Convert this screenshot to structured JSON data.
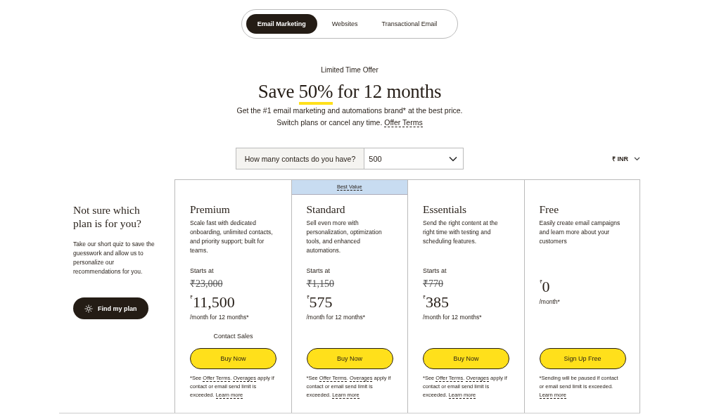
{
  "tabs": [
    {
      "label": "Email Marketing",
      "selected": true
    },
    {
      "label": "Websites",
      "selected": false
    },
    {
      "label": "Transactional Email",
      "selected": false
    }
  ],
  "offer": {
    "eyebrow": "Limited Time Offer",
    "headline_before": "Save ",
    "headline_highlight": "50%",
    "headline_after": " for 12 months",
    "subtitle": "Get the #1 email marketing and automations brand* at the best price.",
    "subtitle2": "Switch plans or cancel any time.",
    "terms_link": "Offer Terms"
  },
  "contacts": {
    "label": "How many contacts do you have?",
    "value": "500"
  },
  "currency": {
    "symbol": "₹",
    "code": "INR"
  },
  "quiz": {
    "title": "Not sure which plan is for you?",
    "text": "Take our short quiz to save the guesswork and allow us to personalize our recommendations for you.",
    "button": "Find my plan"
  },
  "plans": [
    {
      "name": "Premium",
      "description": "Scale fast with dedicated onboarding, unlimited contacts, and priority support; built for teams.",
      "starts": "Starts at",
      "old_price": "₹23,000",
      "currency": "₹",
      "price": "11,500",
      "period": "/month for 12 months*",
      "contact": "Contact Sales",
      "button": "Buy Now",
      "note": [
        {
          "kind": "text",
          "text": "*See "
        },
        {
          "kind": "link",
          "text": "Offer Terms"
        },
        {
          "kind": "text",
          "text": ". "
        },
        {
          "kind": "link",
          "text": "Overages"
        },
        {
          "kind": "text",
          "text": " apply if contact or email send limit is exceeded. "
        },
        {
          "kind": "link",
          "text": "Learn more"
        }
      ]
    },
    {
      "name": "Standard",
      "badge": "Best Value",
      "description": "Sell even more with personalization, optimization tools, and enhanced automations.",
      "starts": "Starts at",
      "old_price": "₹1,150",
      "currency": "₹",
      "price": "575",
      "period": "/month for 12 months*",
      "button": "Buy Now",
      "note": [
        {
          "kind": "text",
          "text": "*See "
        },
        {
          "kind": "link",
          "text": "Offer Terms"
        },
        {
          "kind": "text",
          "text": ". "
        },
        {
          "kind": "link",
          "text": "Overages"
        },
        {
          "kind": "text",
          "text": " apply if contact or email send limit is exceeded. "
        },
        {
          "kind": "link",
          "text": "Learn more"
        }
      ]
    },
    {
      "name": "Essentials",
      "description": "Send the right content at the right time with testing and scheduling features.",
      "starts": "Starts at",
      "old_price": "₹770",
      "currency": "₹",
      "price": "385",
      "period": "/month for 12 months*",
      "button": "Buy Now",
      "note": [
        {
          "kind": "text",
          "text": "*See "
        },
        {
          "kind": "link",
          "text": "Offer Terms"
        },
        {
          "kind": "text",
          "text": ". "
        },
        {
          "kind": "link",
          "text": "Overages"
        },
        {
          "kind": "text",
          "text": " apply if contact or email send limit is exceeded. "
        },
        {
          "kind": "link",
          "text": "Learn more"
        }
      ]
    },
    {
      "name": "Free",
      "description": "Easily create email campaigns and learn more about your customers",
      "currency": "₹",
      "price": "0",
      "period": "/month*",
      "button": "Sign Up Free",
      "note": [
        {
          "kind": "text",
          "text": "*Sending will be paused if contact or email send limit is exceeded. "
        },
        {
          "kind": "link",
          "text": "Learn more"
        }
      ]
    }
  ]
}
